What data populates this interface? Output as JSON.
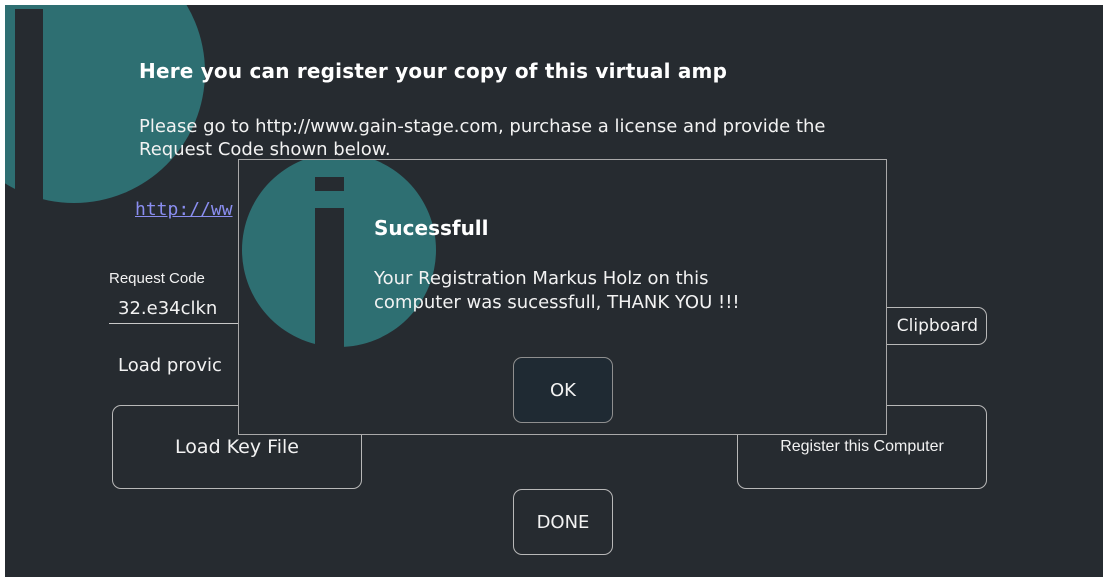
{
  "window": {
    "title": "Here you can register your copy of this virtual amp",
    "instructions_line1": "Please go to http://www.gain-stage.com, purchase a license and provide the",
    "instructions_line2": "Request Code shown below.",
    "link_text": "http://ww",
    "request_code_label": "Request Code",
    "request_code_value": "32.e34clkn",
    "load_provided_label": "Load provic",
    "clipboard_button": "Clipboard",
    "load_key_button": "Load Key File",
    "register_button": "Register this Computer",
    "done_button": "DONE"
  },
  "dialog": {
    "title": "Sucessfull",
    "message_line1": "Your Registration Markus Holz on this",
    "message_line2": "computer was sucessfull, THANK YOU !!!",
    "ok_button": "OK"
  },
  "colors": {
    "background": "#262b30",
    "info_circle": "#2e6f72",
    "link": "#8a8ef0",
    "border": "#b8b8b8"
  },
  "icons": [
    "info-icon",
    "info-icon"
  ]
}
